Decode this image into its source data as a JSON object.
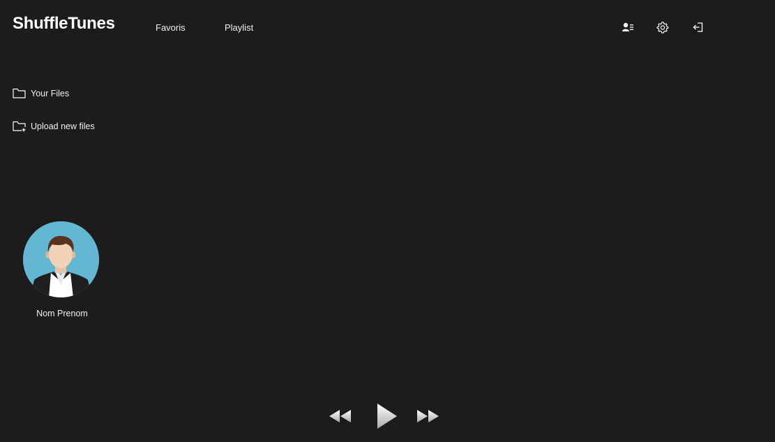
{
  "header": {
    "logo": "ShuffleTunes",
    "nav": {
      "favoris": "Favoris",
      "playlist": "Playlist"
    },
    "icons": [
      "profile-list-icon",
      "gear-icon",
      "logout-icon"
    ]
  },
  "sidebar": {
    "items": [
      {
        "label": "Your Files",
        "icon": "folder-icon"
      },
      {
        "label": "Upload new files",
        "icon": "folder-add-icon"
      }
    ]
  },
  "profile": {
    "name": "Nom Prenom",
    "avatar_icon": "user-avatar"
  },
  "player": {
    "controls": [
      "rewind-icon",
      "play-icon",
      "fast-forward-icon"
    ]
  },
  "colors": {
    "background": "#1d1b1c",
    "text": "#ffffff",
    "avatar_bg": "#63b7d3"
  }
}
